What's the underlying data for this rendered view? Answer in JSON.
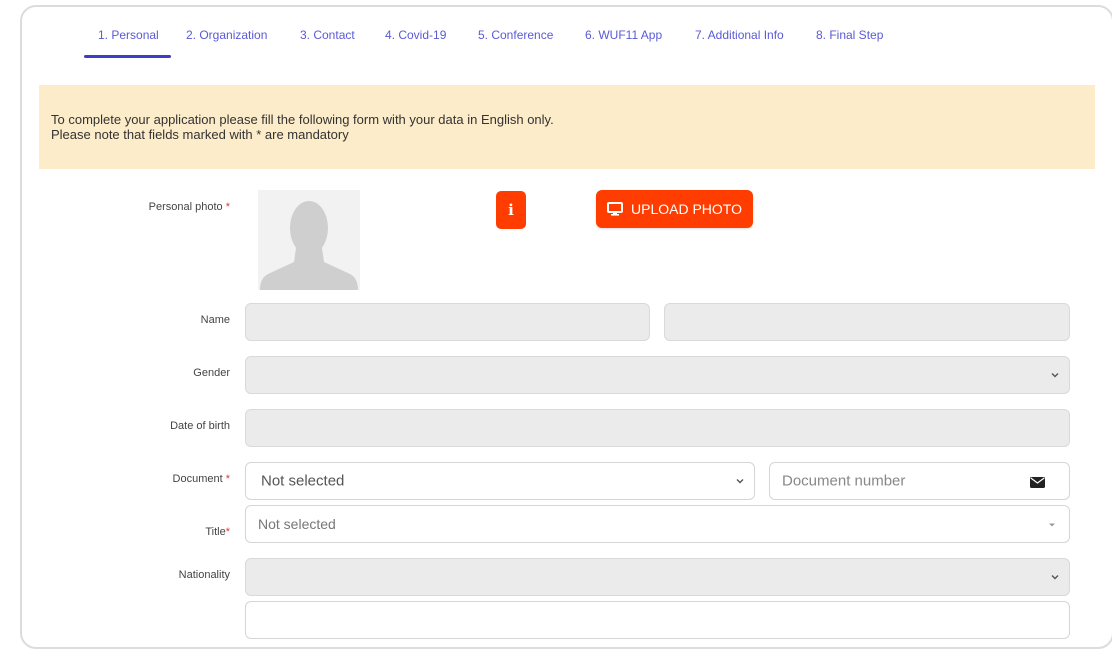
{
  "tabs": [
    {
      "label": "1. Personal",
      "active": true
    },
    {
      "label": "2. Organization"
    },
    {
      "label": "3. Contact"
    },
    {
      "label": "4. Covid-19"
    },
    {
      "label": "5. Conference"
    },
    {
      "label": "6. WUF11 App"
    },
    {
      "label": "7. Additional Info"
    },
    {
      "label": "8. Final Step"
    }
  ],
  "notice": {
    "line1": "To complete your application please fill the following form with your data in English only.",
    "line2": "Please note that fields marked with * are mandatory"
  },
  "form": {
    "photo_label": "Personal photo",
    "required_mark": "*",
    "info_label": "i",
    "upload_label": "UPLOAD PHOTO",
    "name_label": "Name",
    "gender_label": "Gender",
    "dob_label": "Date of birth",
    "document_label": "Document",
    "document_value": "Not selected",
    "document_number_placeholder": "Document number",
    "title_label": "Title",
    "title_value": "Not selected",
    "nationality_label": "Nationality"
  },
  "colors": {
    "accent": "#ff3d00",
    "tab_text": "#5a5ad6",
    "tab_underline": "#3d3dc8",
    "notice_bg": "#fcecc9"
  },
  "icons": [
    "monitor-icon",
    "chevron-down-icon",
    "envelope-icon",
    "caret-down-icon",
    "avatar-placeholder-icon"
  ]
}
